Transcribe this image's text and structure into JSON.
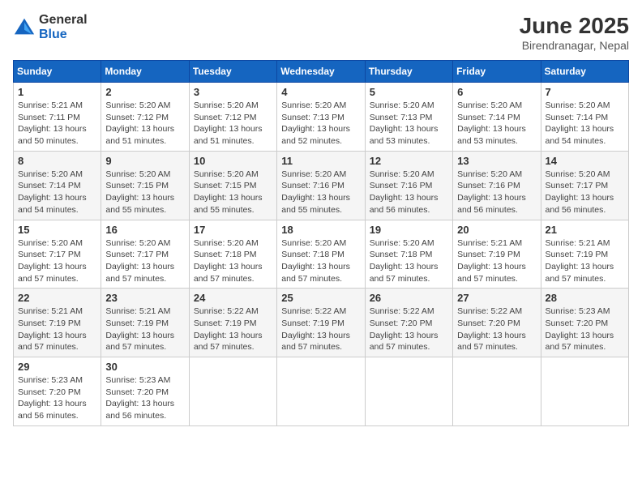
{
  "logo": {
    "general": "General",
    "blue": "Blue"
  },
  "header": {
    "title": "June 2025",
    "subtitle": "Birendranagar, Nepal"
  },
  "calendar": {
    "days_of_week": [
      "Sunday",
      "Monday",
      "Tuesday",
      "Wednesday",
      "Thursday",
      "Friday",
      "Saturday"
    ],
    "weeks": [
      [
        {
          "day": "",
          "info": ""
        },
        {
          "day": "2",
          "info": "Sunrise: 5:20 AM\nSunset: 7:12 PM\nDaylight: 13 hours\nand 51 minutes."
        },
        {
          "day": "3",
          "info": "Sunrise: 5:20 AM\nSunset: 7:12 PM\nDaylight: 13 hours\nand 51 minutes."
        },
        {
          "day": "4",
          "info": "Sunrise: 5:20 AM\nSunset: 7:13 PM\nDaylight: 13 hours\nand 52 minutes."
        },
        {
          "day": "5",
          "info": "Sunrise: 5:20 AM\nSunset: 7:13 PM\nDaylight: 13 hours\nand 53 minutes."
        },
        {
          "day": "6",
          "info": "Sunrise: 5:20 AM\nSunset: 7:14 PM\nDaylight: 13 hours\nand 53 minutes."
        },
        {
          "day": "7",
          "info": "Sunrise: 5:20 AM\nSunset: 7:14 PM\nDaylight: 13 hours\nand 54 minutes."
        }
      ],
      [
        {
          "day": "8",
          "info": "Sunrise: 5:20 AM\nSunset: 7:14 PM\nDaylight: 13 hours\nand 54 minutes."
        },
        {
          "day": "9",
          "info": "Sunrise: 5:20 AM\nSunset: 7:15 PM\nDaylight: 13 hours\nand 55 minutes."
        },
        {
          "day": "10",
          "info": "Sunrise: 5:20 AM\nSunset: 7:15 PM\nDaylight: 13 hours\nand 55 minutes."
        },
        {
          "day": "11",
          "info": "Sunrise: 5:20 AM\nSunset: 7:16 PM\nDaylight: 13 hours\nand 55 minutes."
        },
        {
          "day": "12",
          "info": "Sunrise: 5:20 AM\nSunset: 7:16 PM\nDaylight: 13 hours\nand 56 minutes."
        },
        {
          "day": "13",
          "info": "Sunrise: 5:20 AM\nSunset: 7:16 PM\nDaylight: 13 hours\nand 56 minutes."
        },
        {
          "day": "14",
          "info": "Sunrise: 5:20 AM\nSunset: 7:17 PM\nDaylight: 13 hours\nand 56 minutes."
        }
      ],
      [
        {
          "day": "15",
          "info": "Sunrise: 5:20 AM\nSunset: 7:17 PM\nDaylight: 13 hours\nand 57 minutes."
        },
        {
          "day": "16",
          "info": "Sunrise: 5:20 AM\nSunset: 7:17 PM\nDaylight: 13 hours\nand 57 minutes."
        },
        {
          "day": "17",
          "info": "Sunrise: 5:20 AM\nSunset: 7:18 PM\nDaylight: 13 hours\nand 57 minutes."
        },
        {
          "day": "18",
          "info": "Sunrise: 5:20 AM\nSunset: 7:18 PM\nDaylight: 13 hours\nand 57 minutes."
        },
        {
          "day": "19",
          "info": "Sunrise: 5:20 AM\nSunset: 7:18 PM\nDaylight: 13 hours\nand 57 minutes."
        },
        {
          "day": "20",
          "info": "Sunrise: 5:21 AM\nSunset: 7:19 PM\nDaylight: 13 hours\nand 57 minutes."
        },
        {
          "day": "21",
          "info": "Sunrise: 5:21 AM\nSunset: 7:19 PM\nDaylight: 13 hours\nand 57 minutes."
        }
      ],
      [
        {
          "day": "22",
          "info": "Sunrise: 5:21 AM\nSunset: 7:19 PM\nDaylight: 13 hours\nand 57 minutes."
        },
        {
          "day": "23",
          "info": "Sunrise: 5:21 AM\nSunset: 7:19 PM\nDaylight: 13 hours\nand 57 minutes."
        },
        {
          "day": "24",
          "info": "Sunrise: 5:22 AM\nSunset: 7:19 PM\nDaylight: 13 hours\nand 57 minutes."
        },
        {
          "day": "25",
          "info": "Sunrise: 5:22 AM\nSunset: 7:19 PM\nDaylight: 13 hours\nand 57 minutes."
        },
        {
          "day": "26",
          "info": "Sunrise: 5:22 AM\nSunset: 7:20 PM\nDaylight: 13 hours\nand 57 minutes."
        },
        {
          "day": "27",
          "info": "Sunrise: 5:22 AM\nSunset: 7:20 PM\nDaylight: 13 hours\nand 57 minutes."
        },
        {
          "day": "28",
          "info": "Sunrise: 5:23 AM\nSunset: 7:20 PM\nDaylight: 13 hours\nand 57 minutes."
        }
      ],
      [
        {
          "day": "29",
          "info": "Sunrise: 5:23 AM\nSunset: 7:20 PM\nDaylight: 13 hours\nand 56 minutes."
        },
        {
          "day": "30",
          "info": "Sunrise: 5:23 AM\nSunset: 7:20 PM\nDaylight: 13 hours\nand 56 minutes."
        },
        {
          "day": "",
          "info": ""
        },
        {
          "day": "",
          "info": ""
        },
        {
          "day": "",
          "info": ""
        },
        {
          "day": "",
          "info": ""
        },
        {
          "day": "",
          "info": ""
        }
      ]
    ],
    "first_day": {
      "day": "1",
      "info": "Sunrise: 5:21 AM\nSunset: 7:11 PM\nDaylight: 13 hours\nand 50 minutes."
    }
  }
}
